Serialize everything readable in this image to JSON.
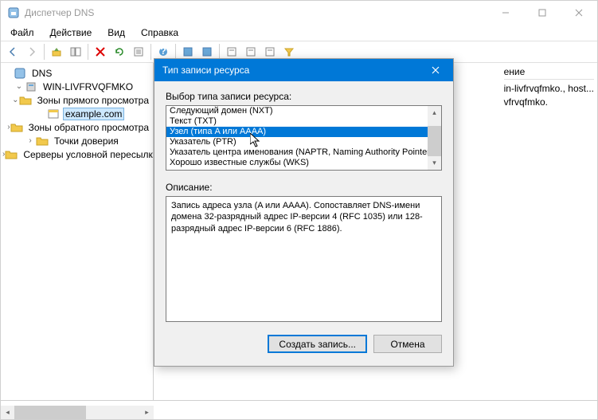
{
  "window": {
    "title": "Диспетчер DNS"
  },
  "menu": {
    "file": "Файл",
    "action": "Действие",
    "view": "Вид",
    "help": "Справка"
  },
  "tree": {
    "root": "DNS",
    "server": "WIN-LIVFRVQFMKO",
    "fwd_zones": "Зоны прямого просмотра",
    "example": "example.com",
    "rev_zones": "Зоны обратного просмотра",
    "trust_points": "Точки доверия",
    "cond_forwarders": "Серверы условной пересылки"
  },
  "list_partial": {
    "col_truncated": "ение",
    "server_hint": "in-livfrvqfmko., host...",
    "zone_hint": "vfrvqfmko."
  },
  "dialog": {
    "title": "Тип записи ресурса",
    "select_label": "Выбор типа записи ресурса:",
    "items": {
      "nxt": "Следующий домен (NXT)",
      "txt": "Текст (TXT)",
      "a_aaaa": "Узел (типа A или AAAA)",
      "ptr": "Указатель (PTR)",
      "naptr": "Указатель центра именования (NAPTR, Naming Authority Pointer)",
      "wks": "Хорошо известные службы (WKS)"
    },
    "desc_label": "Описание:",
    "desc_text": "Запись адреса узла (A или AAAA). Сопоставляет DNS-имени домена 32-разрядный адрес IP-версии 4 (RFC 1035) или 128-разрядный адрес IP-версии 6 (RFC 1886).",
    "create_btn": "Создать запись...",
    "cancel_btn": "Отмена"
  }
}
